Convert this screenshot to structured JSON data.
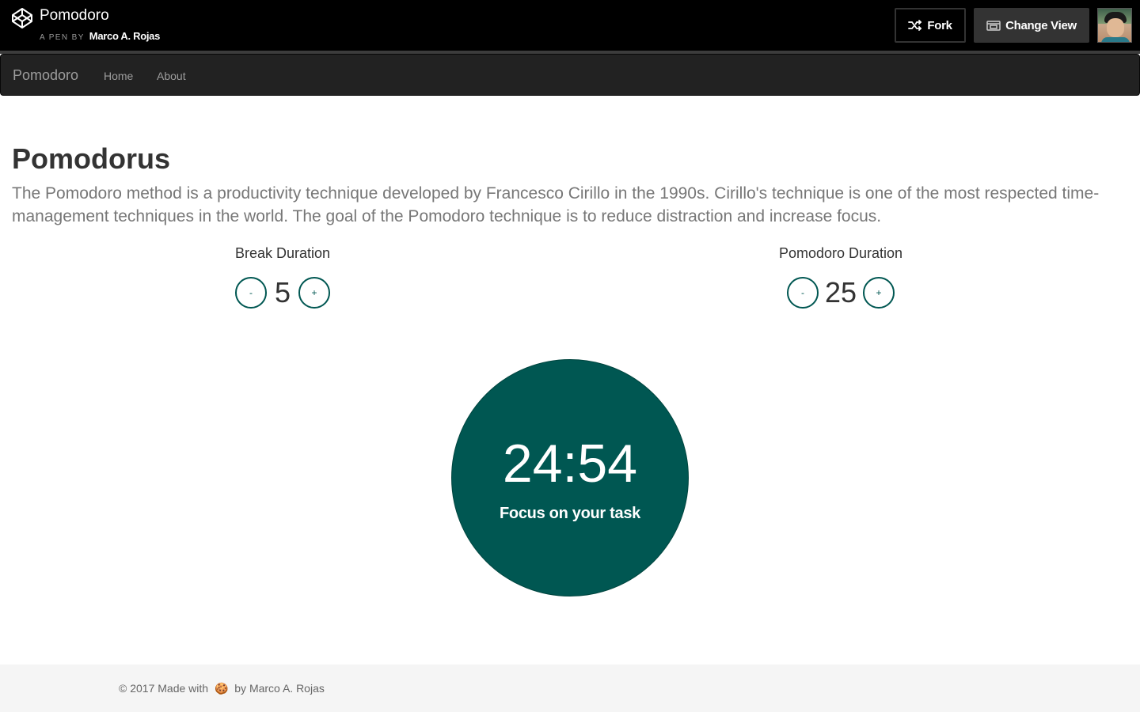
{
  "codepen_bar": {
    "pen_title": "Pomodoro",
    "byline_prefix": "A PEN BY",
    "author": "Marco A. Rojas",
    "fork_label": "Fork",
    "change_view_label": "Change View",
    "logo_icon": "codepen-logo-icon",
    "avatar": "user-avatar"
  },
  "navbar": {
    "brand": "Pomodoro",
    "links": [
      "Home",
      "About"
    ]
  },
  "main": {
    "title": "Pomodorus",
    "description": "The Pomodoro method is a productivity technique developed by Francesco Cirillo in the 1990s. Cirillo's technique is one of the most respected time-management techniques in the world. The goal of the Pomodoro technique is to reduce distraction and increase focus.",
    "break": {
      "label": "Break Duration",
      "value": "5",
      "minus": "-",
      "plus": "+"
    },
    "pomodoro": {
      "label": "Pomodoro Duration",
      "value": "25",
      "minus": "-",
      "plus": "+"
    },
    "timer": {
      "time": "24:54",
      "status": "Focus on your task"
    }
  },
  "footer": {
    "text_before": "© 2017 Made with",
    "emoji": "🍪",
    "text_after": "by Marco A. Rojas"
  },
  "colors": {
    "accent": "#005752",
    "navbar_bg": "#222222",
    "topbar_bg": "#000000",
    "footer_bg": "#f5f5f5"
  }
}
